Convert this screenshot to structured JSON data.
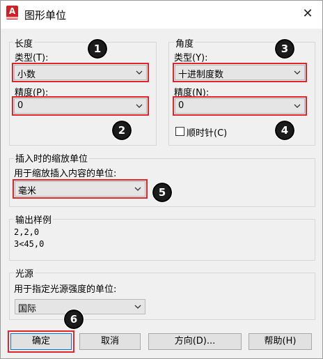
{
  "window": {
    "title": "图形单位",
    "close": "✕",
    "app_icon_letter": "A"
  },
  "length": {
    "group_label": "长度",
    "type_label": "类型(T):",
    "type_value": "小数",
    "precision_label": "精度(P):",
    "precision_value": "0"
  },
  "angle": {
    "group_label": "角度",
    "type_label": "类型(Y):",
    "type_value": "十进制度数",
    "precision_label": "精度(N):",
    "precision_value": "0",
    "clockwise_label": "顺时针(C)",
    "clockwise_checked": false
  },
  "insertion": {
    "group_label": "插入时的缩放单位",
    "units_label": "用于缩放插入内容的单位:",
    "units_value": "毫米"
  },
  "sample": {
    "group_label": "输出样例",
    "line1": "2,2,0",
    "line2": "3<45,0"
  },
  "lighting": {
    "group_label": "光源",
    "units_label": "用于指定光源强度的单位:",
    "units_value": "国际"
  },
  "buttons": {
    "ok": "确定",
    "cancel": "取消",
    "direction": "方向(D)...",
    "help": "帮助(H)"
  },
  "annotations": [
    "1",
    "2",
    "3",
    "4",
    "5",
    "6"
  ],
  "colors": {
    "highlight": "#e0262b",
    "badge": "#1b1b1b",
    "app_icon": "#d02027"
  }
}
